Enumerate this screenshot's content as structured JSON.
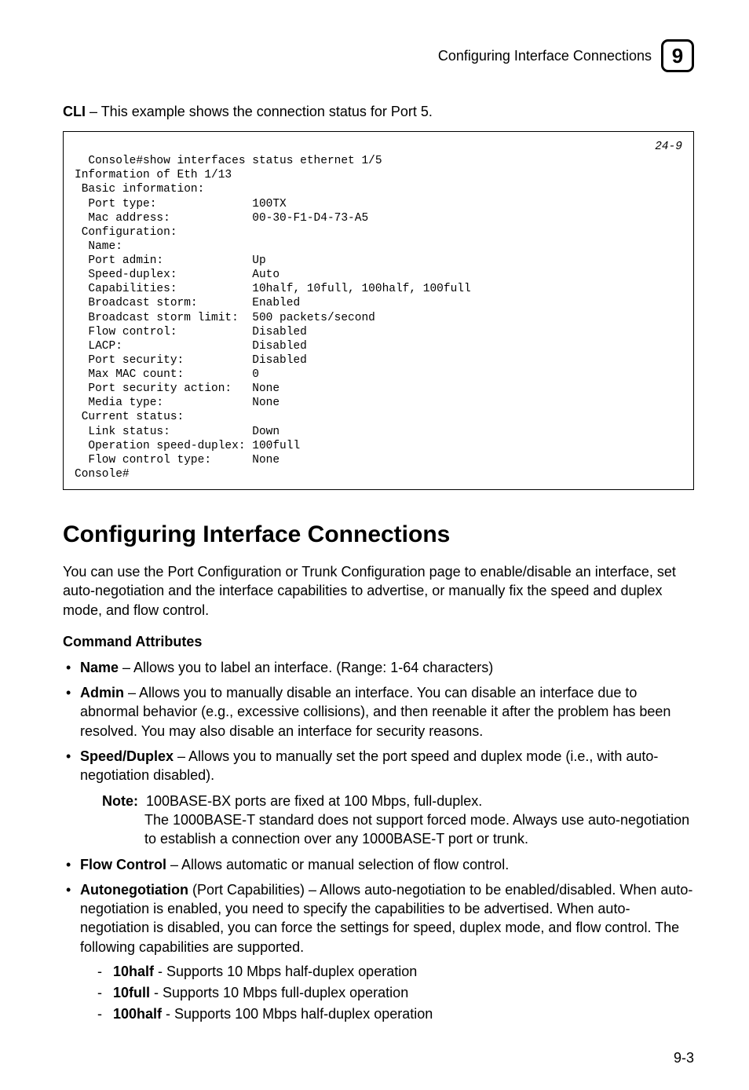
{
  "header": {
    "title": "Configuring Interface Connections",
    "chapter_number": "9"
  },
  "cli_intro": {
    "bold": "CLI",
    "rest": " – This example shows the connection status for Port 5."
  },
  "cli": {
    "ref": "24-9",
    "lines": "Console#show interfaces status ethernet 1/5\nInformation of Eth 1/13\n Basic information:\n  Port type:              100TX\n  Mac address:            00-30-F1-D4-73-A5\n Configuration:\n  Name:\n  Port admin:             Up\n  Speed-duplex:           Auto\n  Capabilities:           10half, 10full, 100half, 100full\n  Broadcast storm:        Enabled\n  Broadcast storm limit:  500 packets/second\n  Flow control:           Disabled\n  LACP:                   Disabled\n  Port security:          Disabled\n  Max MAC count:          0\n  Port security action:   None\n  Media type:             None\n Current status:\n  Link status:            Down\n  Operation speed-duplex: 100full\n  Flow control type:      None\nConsole#"
  },
  "h1": "Configuring Interface Connections",
  "intro_para": "You can use the Port Configuration or Trunk Configuration page to enable/disable an interface, set auto-negotiation and the interface capabilities to advertise, or manually fix the speed and duplex mode, and flow control.",
  "cmd_attr_label": "Command Attributes",
  "bullets": {
    "name": {
      "b": "Name",
      "t": " – Allows you to label an interface. (Range: 1-64 characters)"
    },
    "admin": {
      "b": "Admin",
      "t": " – Allows you to manually disable an interface. You can disable an interface due to abnormal behavior (e.g., excessive collisions), and then reenable it after the problem has been resolved. You may also disable an interface for security reasons."
    },
    "speed": {
      "b": "Speed/Duplex",
      "t": " – Allows you to manually set the port speed and duplex mode (i.e., with auto-negotiation disabled)."
    },
    "flow": {
      "b": "Flow Control",
      "t": " – Allows automatic or manual selection of flow control."
    },
    "auto": {
      "b": "Autonegotiation",
      "t": " (Port Capabilities) – Allows auto-negotiation to be enabled/disabled. When auto-negotiation is enabled, you need to specify the capabilities to be advertised. When auto-negotiation is disabled, you can force the settings for speed, duplex mode, and flow control. The following capabilities are supported."
    }
  },
  "note": {
    "label": "Note:",
    "line1": "100BASE-BX ports are fixed at 100 Mbps, full-duplex.",
    "line2": "The 1000BASE-T standard does not support forced mode. Always use auto-negotiation to establish a connection over any 1000BASE-T port or trunk."
  },
  "subcaps": {
    "c1": {
      "b": "10half",
      "t": " - Supports 10 Mbps half-duplex operation"
    },
    "c2": {
      "b": "10full",
      "t": " - Supports 10 Mbps full-duplex operation"
    },
    "c3": {
      "b": "100half",
      "t": " - Supports 100 Mbps half-duplex operation"
    }
  },
  "page_number": "9-3"
}
